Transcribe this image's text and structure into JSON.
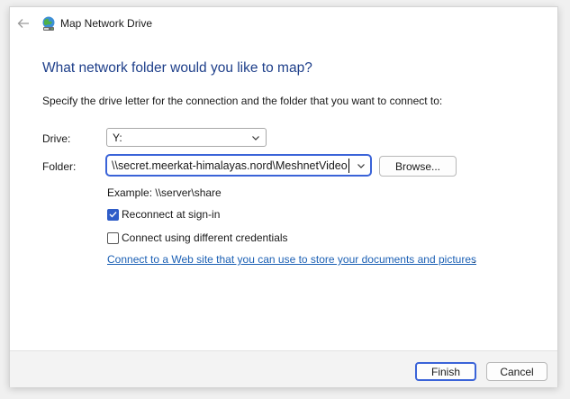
{
  "window": {
    "title": "Map Network Drive"
  },
  "main": {
    "heading": "What network folder would you like to map?",
    "instruction": "Specify the drive letter for the connection and the folder that you want to connect to:",
    "drive": {
      "label": "Drive:",
      "value": "Y:"
    },
    "folder": {
      "label": "Folder:",
      "value": "\\\\secret.meerkat-himalayas.nord\\MeshnetVideos"
    },
    "browse_label": "Browse...",
    "example": "Example: \\\\server\\share",
    "reconnect": {
      "label": "Reconnect at sign-in",
      "checked": true
    },
    "different_credentials": {
      "label": "Connect using different credentials",
      "checked": false
    },
    "web_link": {
      "text": "Connect to a Web site that you can use to store your documents and pictures",
      "suffix": "."
    }
  },
  "footer": {
    "finish_label": "Finish",
    "cancel_label": "Cancel"
  },
  "colors": {
    "heading": "#1e3f8a",
    "accent": "#3a63d8",
    "checkbox": "#2f5dc8",
    "link": "#1a5fb4"
  },
  "icons": {
    "back": "back-arrow-icon",
    "app": "network-drive-icon",
    "dropdown": "chevron-down-icon",
    "check": "checkmark-icon"
  }
}
